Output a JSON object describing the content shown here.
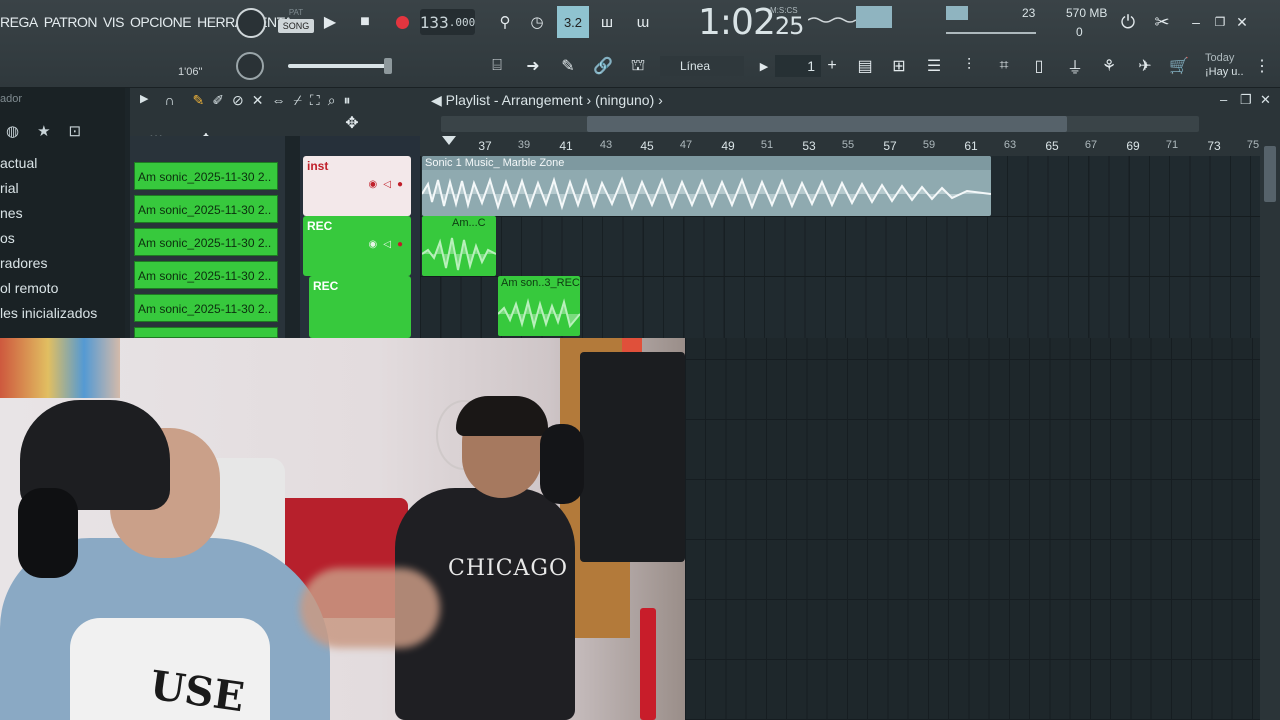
{
  "menu": {
    "items": [
      "REGA",
      "PATRON",
      "VIS",
      "OPCIONE",
      "HERRAMIENTA"
    ]
  },
  "transport": {
    "pat_label": "PAT",
    "song_label": "SONG",
    "tempo": "133",
    "tempo_decimals": ".000",
    "time_main": "1:02",
    "time_cs": "25",
    "time_format_label": "M:S:CS",
    "small_time": "1'06\"",
    "step_value": "1"
  },
  "monitor": {
    "ram": "570 MB",
    "polyphony": "0",
    "voices": "23"
  },
  "toolbar": {
    "snap_label": "Línea",
    "news_date": "Today",
    "news_text": "¡Hay u.."
  },
  "browser": {
    "title": "ador",
    "items": [
      "actual",
      "rial",
      "nes",
      "os",
      "radores",
      "ol remoto",
      "les inicializados"
    ]
  },
  "patterns": [
    "Am sonic_2025-11-30 2..",
    "Am sonic_2025-11-30 2..",
    "Am sonic_2025-11-30 2..",
    "Am sonic_2025-11-30 2..",
    "Am sonic_2025-11-30 2.."
  ],
  "playlist": {
    "title": "Playlist - Arrangement",
    "pattern": "(ninguno)",
    "ruler_ticks": [
      "37",
      "39",
      "41",
      "43",
      "45",
      "47",
      "49",
      "51",
      "53",
      "55",
      "57",
      "59",
      "61",
      "63",
      "65",
      "67",
      "69",
      "71",
      "73",
      "75"
    ],
    "tracks": [
      {
        "name": "inst",
        "color": "#f3e8ea"
      },
      {
        "name": "REC",
        "color": "#37c93d"
      },
      {
        "name": "REC",
        "color": "#37c93d"
      }
    ],
    "clips": [
      {
        "label": "Sonic 1 Music_ Marble Zone",
        "color": "#8faab0"
      },
      {
        "label": "Am...C",
        "color": "#37c93d"
      },
      {
        "label": "Am son..3_REC",
        "color": "#37c93d"
      }
    ]
  },
  "webcam": {
    "shirt_text": "CHICAGO",
    "shirt2_text": "USE"
  }
}
